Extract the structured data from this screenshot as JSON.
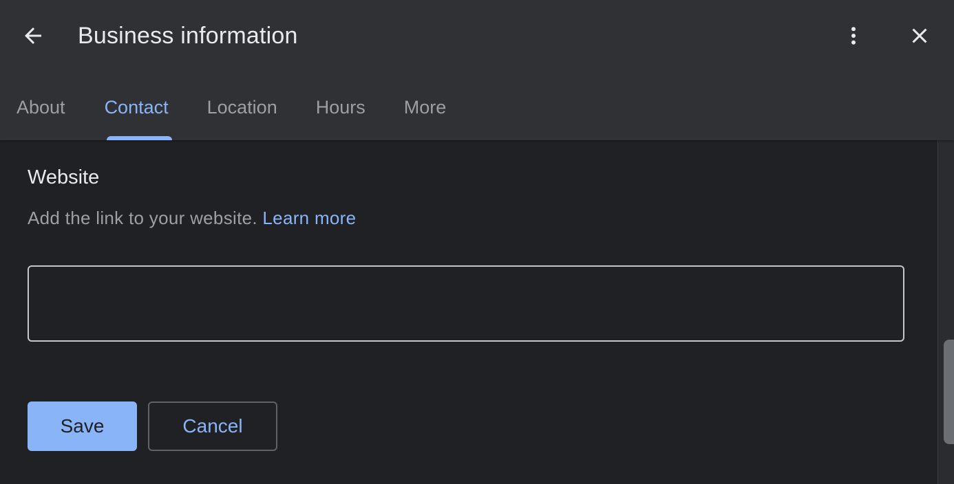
{
  "header": {
    "title": "Business information",
    "back_icon": "arrow-left-icon",
    "more_icon": "more-vertical-icon",
    "close_icon": "close-icon"
  },
  "tabs": [
    {
      "label": "About",
      "active": false
    },
    {
      "label": "Contact",
      "active": true
    },
    {
      "label": "Location",
      "active": false
    },
    {
      "label": "Hours",
      "active": false
    },
    {
      "label": "More",
      "active": false
    }
  ],
  "website": {
    "title": "Website",
    "description": "Add the link to your website.",
    "learn_more": "Learn more",
    "input_value": "",
    "input_placeholder": ""
  },
  "actions": {
    "save_label": "Save",
    "cancel_label": "Cancel"
  },
  "colors": {
    "accent": "#8ab4f8",
    "header_bg": "#303134",
    "content_bg": "#202124",
    "text_primary": "#e8eaed",
    "text_secondary": "#9aa0a6"
  }
}
